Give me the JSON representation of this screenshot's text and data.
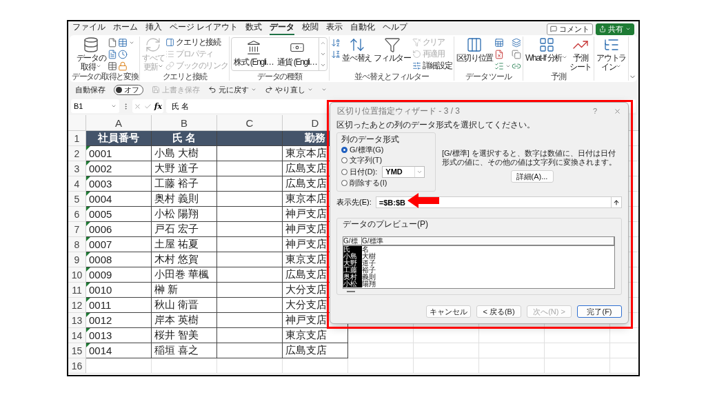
{
  "menu_tabs": [
    {
      "label": "ファイル",
      "selected": false
    },
    {
      "label": "ホーム",
      "selected": false
    },
    {
      "label": "挿入",
      "selected": false
    },
    {
      "label": "ページ レイアウト",
      "selected": false
    },
    {
      "label": "数式",
      "selected": false
    },
    {
      "label": "データ",
      "selected": true
    },
    {
      "label": "校閲",
      "selected": false
    },
    {
      "label": "表示",
      "selected": false
    },
    {
      "label": "自動化",
      "selected": false
    },
    {
      "label": "ヘルプ",
      "selected": false
    }
  ],
  "header_buttons": [
    {
      "label": "コメント",
      "kind": "outline"
    },
    {
      "label": "共有",
      "kind": "primary"
    }
  ],
  "ribbon": {
    "groups": [
      {
        "label": "データの取得と変換",
        "items": [
          {
            "kind": "large",
            "lines": [
              "データの",
              "取得"
            ],
            "dropdown": true,
            "disabled": false
          },
          {
            "kind": "icon",
            "dropdown": false,
            "disabled": false
          },
          {
            "kind": "icon",
            "dropdown": false,
            "disabled": false
          },
          {
            "kind": "icon",
            "dropdown": false,
            "disabled": false
          },
          {
            "kind": "icon",
            "dropdown": true,
            "disabled": false
          },
          {
            "kind": "icon",
            "dropdown": false,
            "disabled": false
          },
          {
            "kind": "icon",
            "dropdown": false,
            "disabled": false
          }
        ]
      },
      {
        "label": "クエリと接続",
        "items": [
          {
            "kind": "large",
            "lines": [
              "すべて",
              "更新"
            ],
            "dropdown": true,
            "disabled": true
          },
          {
            "kind": "small",
            "label": "クエリと接続",
            "disabled": false
          },
          {
            "kind": "small",
            "label": "プロパティ",
            "disabled": true
          },
          {
            "kind": "small",
            "label": "ブックのリンク",
            "disabled": true
          }
        ]
      },
      {
        "label": "データの種類",
        "items": [
          {
            "kind": "gallery",
            "entries": [
              {
                "label": "株式 (Engli…"
              },
              {
                "label": "通貨 (Engli…"
              }
            ],
            "disabled": false
          }
        ]
      },
      {
        "label": "並べ替えとフィルター",
        "items": [
          {
            "kind": "icon",
            "dropdown": false,
            "disabled": false
          },
          {
            "kind": "icon",
            "dropdown": false,
            "disabled": false
          },
          {
            "kind": "large",
            "lines": [
              "並べ替え"
            ],
            "dropdown": false,
            "disabled": false
          },
          {
            "kind": "large",
            "lines": [
              "フィルター"
            ],
            "dropdown": false,
            "disabled": false
          },
          {
            "kind": "small",
            "label": "クリア",
            "disabled": true
          },
          {
            "kind": "small",
            "label": "再適用",
            "disabled": true
          },
          {
            "kind": "small",
            "label": "詳細設定",
            "disabled": false
          }
        ]
      },
      {
        "label": "データ ツール",
        "items": [
          {
            "kind": "large",
            "lines": [
              "区切り位置"
            ],
            "dropdown": false,
            "disabled": false
          },
          {
            "kind": "icon",
            "dropdown": false,
            "disabled": false
          },
          {
            "kind": "icon",
            "dropdown": false,
            "disabled": false
          },
          {
            "kind": "icon",
            "dropdown": true,
            "disabled": false
          },
          {
            "kind": "icon",
            "dropdown": false,
            "disabled": false
          },
          {
            "kind": "icon",
            "dropdown": false,
            "disabled": false
          },
          {
            "kind": "icon",
            "dropdown": false,
            "disabled": false
          }
        ]
      },
      {
        "label": "予測",
        "items": [
          {
            "kind": "large",
            "lines": [
              "What-If 分析"
            ],
            "dropdown": true,
            "disabled": false
          },
          {
            "kind": "large",
            "lines": [
              "予測",
              "シート"
            ],
            "dropdown": false,
            "disabled": false
          }
        ]
      },
      {
        "items": [
          {
            "kind": "large",
            "lines": [
              "アウトラ",
              "イン"
            ],
            "dropdown": true,
            "disabled": false
          }
        ]
      }
    ]
  },
  "quick_access": {
    "autosave": {
      "label": "自動保存",
      "on": false,
      "state_label": "オフ"
    },
    "items": [
      {
        "label": "上書き保存",
        "dropdown": false,
        "disabled": true
      },
      {
        "label": "元に戻す",
        "dropdown": true,
        "disabled": false
      },
      {
        "label": "やり直し",
        "dropdown": true,
        "disabled": false
      }
    ]
  },
  "formula_bar": {
    "name_box": "B1",
    "function_label": "fx",
    "formula": "氏 名"
  },
  "sheet": {
    "columns": [
      "A",
      "B",
      "C",
      "D"
    ],
    "rows": [
      {
        "number": "1",
        "kind": "header",
        "cells": [
          "社員番号",
          "氏 名",
          null,
          "勤務"
        ]
      },
      {
        "number": "2",
        "kind": "data",
        "flag": true,
        "cells": [
          "0001",
          "小島 大樹",
          null,
          "東京本店"
        ]
      },
      {
        "number": "3",
        "kind": "data",
        "flag": true,
        "cells": [
          "0002",
          "大野 道子",
          null,
          "広島支店"
        ]
      },
      {
        "number": "4",
        "kind": "data",
        "flag": true,
        "cells": [
          "0003",
          "工藤 裕子",
          null,
          "広島支店"
        ]
      },
      {
        "number": "5",
        "kind": "data",
        "flag": true,
        "cells": [
          "0004",
          "奥村 義則",
          null,
          "東京本店"
        ]
      },
      {
        "number": "6",
        "kind": "data",
        "flag": true,
        "cells": [
          "0005",
          "小松 陽翔",
          null,
          "神戸支店"
        ]
      },
      {
        "number": "7",
        "kind": "data",
        "flag": true,
        "cells": [
          "0006",
          "戸石 宏子",
          null,
          "神戸支店"
        ]
      },
      {
        "number": "8",
        "kind": "data",
        "flag": true,
        "cells": [
          "0007",
          "土屋 祐夏",
          null,
          "神戸支店"
        ]
      },
      {
        "number": "9",
        "kind": "data",
        "flag": true,
        "cells": [
          "0008",
          "木村 悠賀",
          null,
          "東京支店"
        ]
      },
      {
        "number": "10",
        "kind": "data",
        "flag": true,
        "cells": [
          "0009",
          "小田巻 華楓",
          null,
          "広島支店"
        ]
      },
      {
        "number": "11",
        "kind": "data",
        "flag": true,
        "cells": [
          "0010",
          "榊 新",
          null,
          "大分支店"
        ]
      },
      {
        "number": "12",
        "kind": "data",
        "flag": true,
        "cells": [
          "0011",
          "秋山 衛晋",
          null,
          "大分支店"
        ]
      },
      {
        "number": "13",
        "kind": "data",
        "flag": true,
        "cells": [
          "0012",
          "岸本 英樹",
          null,
          "神戸支店"
        ]
      },
      {
        "number": "14",
        "kind": "data",
        "flag": true,
        "cells": [
          "0013",
          "桜井 智美",
          null,
          "東京支店"
        ]
      },
      {
        "number": "15",
        "kind": "data",
        "flag": true,
        "cells": [
          "0014",
          "稲垣 喜之",
          null,
          "広島支店"
        ]
      },
      {
        "number": "16",
        "kind": "empty"
      }
    ]
  },
  "dialog": {
    "title": "区切り位置指定ウィザード - 3 / 3",
    "help": "?",
    "instruction": "区切ったあとの列のデータ形式を選択してください。",
    "format_group": "列のデータ形式",
    "formats": [
      {
        "label": "G/標準(G)",
        "selected": true
      },
      {
        "label": "文字列(T)",
        "selected": false
      },
      {
        "label": "日付(D):",
        "selected": false,
        "select_value": "YMD"
      },
      {
        "label": "削除する(I)",
        "selected": false
      }
    ],
    "description": "[G/標準] を選択すると、数字は数値に、日付は日付形式の値に、その他の値は文字列に変換されます。",
    "detail_button": "詳細(A)...",
    "destination": {
      "label": "表示先(E):",
      "value": "=$B:$B"
    },
    "preview": {
      "label": "データのプレビュー(P)",
      "columns": [
        {
          "header": "G/標",
          "selected": true,
          "cells": [
            "氏",
            "小島",
            "大野",
            "工藤",
            "奥村",
            "小松"
          ]
        },
        {
          "header": "G/標準",
          "selected": false,
          "cells": [
            "名",
            "大樹",
            "道子",
            "裕子",
            "義則",
            "陽翔"
          ]
        }
      ]
    },
    "buttons": [
      {
        "label": "キャンセル",
        "disabled": false,
        "default": false
      },
      {
        "label": "< 戻る(B)",
        "disabled": false,
        "default": false
      },
      {
        "label": "次へ(N) >",
        "disabled": true,
        "default": false
      },
      {
        "label": "完了(F)",
        "disabled": false,
        "default": true
      }
    ]
  }
}
